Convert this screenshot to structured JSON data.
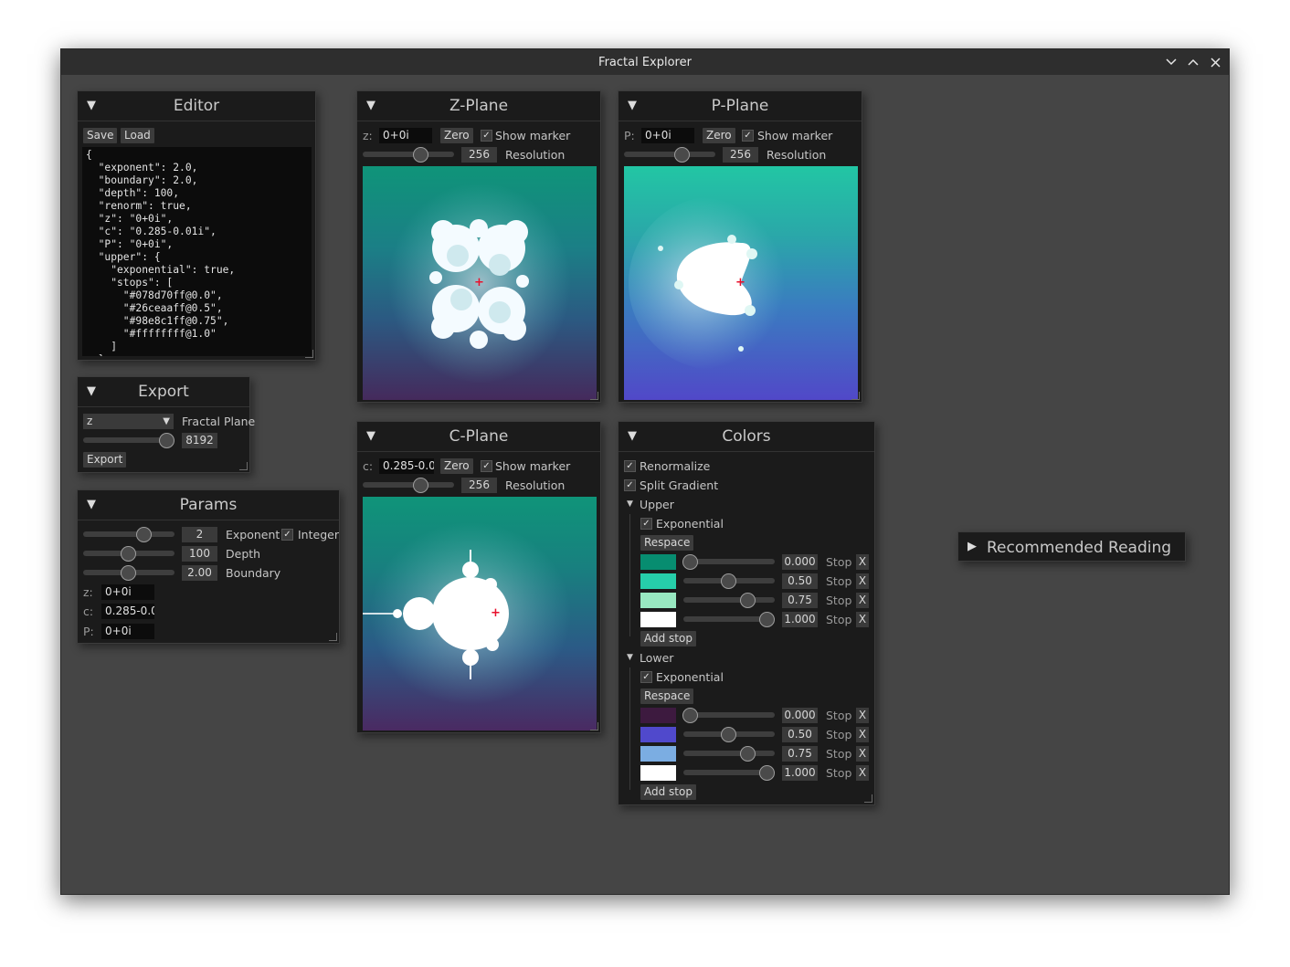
{
  "window": {
    "title": "Fractal Explorer"
  },
  "editor": {
    "title": "Editor",
    "save": "Save",
    "load": "Load",
    "code": "{\n  \"exponent\": 2.0,\n  \"boundary\": 2.0,\n  \"depth\": 100,\n  \"renorm\": true,\n  \"z\": \"0+0i\",\n  \"c\": \"0.285-0.01i\",\n  \"P\": \"0+0i\",\n  \"upper\": {\n    \"exponential\": true,\n    \"stops\": [\n      \"#078d70ff@0.0\",\n      \"#26ceaaff@0.5\",\n      \"#98e8c1ff@0.75\",\n      \"#ffffffff@1.0\"\n    ]\n  },"
  },
  "export": {
    "title": "Export",
    "plane_value": "z",
    "plane_label": "Fractal Plane",
    "size": "8192",
    "button": "Export"
  },
  "params": {
    "title": "Params",
    "exponent_value": "2",
    "exponent_label": "Exponent",
    "integer_label": "Integer",
    "depth_value": "100",
    "depth_label": "Depth",
    "boundary_value": "2.00",
    "boundary_label": "Boundary",
    "z_label": "z:",
    "z_value": "0+0i",
    "c_label": "c:",
    "c_value": "0.285-0.0",
    "p_label": "P:",
    "p_value": "0+0i"
  },
  "zplane": {
    "title": "Z-Plane",
    "prefix": "z:",
    "value": "0+0i",
    "zero": "Zero",
    "show_marker": "Show marker",
    "resolution_value": "256",
    "resolution_label": "Resolution"
  },
  "pplane": {
    "title": "P-Plane",
    "prefix": "P:",
    "value": "0+0i",
    "zero": "Zero",
    "show_marker": "Show marker",
    "resolution_value": "256",
    "resolution_label": "Resolution"
  },
  "cplane": {
    "title": "C-Plane",
    "prefix": "c:",
    "value": "0.285-0.0",
    "zero": "Zero",
    "show_marker": "Show marker",
    "resolution_value": "256",
    "resolution_label": "Resolution"
  },
  "colors": {
    "title": "Colors",
    "renormalize": "Renormalize",
    "split_gradient": "Split Gradient",
    "upper": {
      "label": "Upper",
      "exponential": "Exponential",
      "respace": "Respace",
      "add_stop": "Add stop",
      "stops": [
        {
          "value": "0.000",
          "color": "#078d70",
          "stop": "Stop",
          "x": "X"
        },
        {
          "value": "0.50",
          "color": "#26ceaa",
          "stop": "Stop",
          "x": "X"
        },
        {
          "value": "0.75",
          "color": "#98e8c1",
          "stop": "Stop",
          "x": "X"
        },
        {
          "value": "1.000",
          "color": "#ffffff",
          "stop": "Stop",
          "x": "X"
        }
      ]
    },
    "lower": {
      "label": "Lower",
      "exponential": "Exponential",
      "respace": "Respace",
      "add_stop": "Add stop",
      "stops": [
        {
          "value": "0.000",
          "color": "#3d1a3f",
          "stop": "Stop",
          "x": "X"
        },
        {
          "value": "0.50",
          "color": "#5049cc",
          "stop": "Stop",
          "x": "X"
        },
        {
          "value": "0.75",
          "color": "#7bade2",
          "stop": "Stop",
          "x": "X"
        },
        {
          "value": "1.000",
          "color": "#ffffff",
          "stop": "Stop",
          "x": "X"
        }
      ]
    }
  },
  "reading": {
    "title": "Recommended Reading"
  },
  "icons": {
    "collapse": "▼",
    "expand": "▶",
    "check": "✓",
    "marker": "+",
    "minimize": "⌄",
    "maximize": "⌃",
    "close": "✕",
    "dropdown": "▼"
  }
}
